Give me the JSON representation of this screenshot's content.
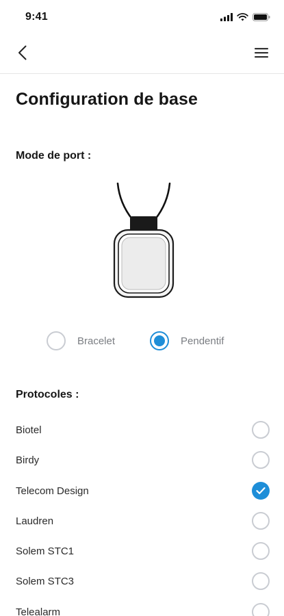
{
  "status_bar": {
    "time": "9:41",
    "icons": [
      "signal-icon",
      "wifi-icon",
      "battery-icon"
    ]
  },
  "nav": {
    "back_icon": "chevron-left-icon",
    "menu_icon": "hamburger-menu-icon"
  },
  "page": {
    "title": "Configuration de base"
  },
  "wear_mode": {
    "label": "Mode de port :",
    "illustration": "pendant-device-icon",
    "options": [
      {
        "label": "Bracelet",
        "selected": false
      },
      {
        "label": "Pendentif",
        "selected": true
      }
    ]
  },
  "protocols": {
    "label": "Protocoles :",
    "items": [
      {
        "label": "Biotel",
        "checked": false
      },
      {
        "label": "Birdy",
        "checked": false
      },
      {
        "label": "Telecom Design",
        "checked": true
      },
      {
        "label": "Laudren",
        "checked": false
      },
      {
        "label": "Solem STC1",
        "checked": false
      },
      {
        "label": "Solem STC3",
        "checked": false
      },
      {
        "label": "Telealarm",
        "checked": false
      }
    ]
  },
  "colors": {
    "accent": "#1e8ed8",
    "radio_border": "#c9ccd2",
    "divider": "#e6e6e6"
  }
}
